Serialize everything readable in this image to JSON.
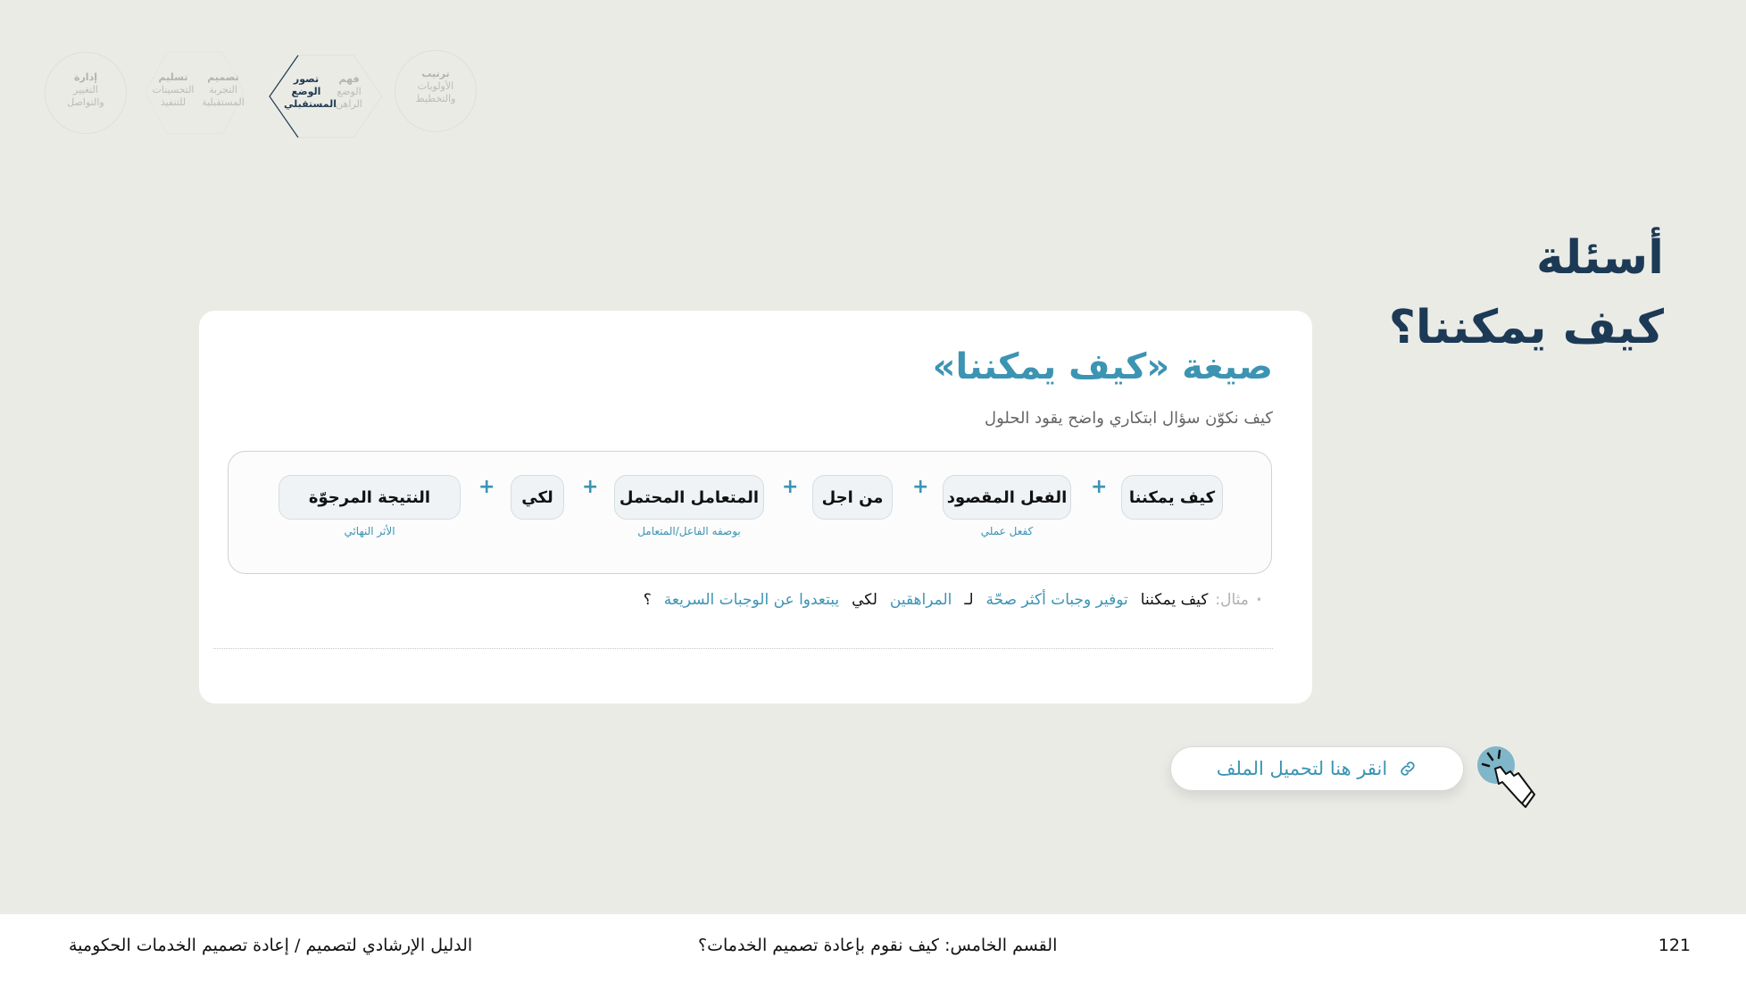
{
  "nav": {
    "stages": [
      {
        "title": "ترتيب",
        "sub1": "الأولويات",
        "sub2": "والتخطيط"
      },
      {
        "title": "فهم",
        "sub1": "الوضع",
        "sub2": "الراهن"
      },
      {
        "title": "تصور",
        "sub1": "الوضع",
        "sub2": "المستقبلي"
      },
      {
        "title": "تصميم",
        "sub1": "التجربة",
        "sub2": "المستقبلية"
      },
      {
        "title": "تسليم",
        "sub1": "التحسينات",
        "sub2": "للتنفيذ"
      },
      {
        "title": "إدارة",
        "sub1": "التغيير",
        "sub2": "والتواصل"
      }
    ]
  },
  "heading": {
    "line1": "أسئلة",
    "line2": "كيف يمكننا؟"
  },
  "card": {
    "title": "صيغة «كيف يمكننا»",
    "subtitle": "كيف نكوّن سؤال ابتكاري واضح يقود الحلول",
    "formula": {
      "chips": [
        {
          "label": "كيف يمكننا",
          "note": ""
        },
        {
          "label": "الفعل المقصود",
          "note": "كفعل عملي"
        },
        {
          "label": "من اجل",
          "note": ""
        },
        {
          "label": "المتعامل المحتمل",
          "note": "بوصفه الفاعل/المتعامل"
        },
        {
          "label": "لكي",
          "note": ""
        },
        {
          "label": "النتيجة المرجوّة",
          "note": "الأثر النهائي"
        }
      ],
      "plus": "+"
    },
    "example": {
      "label": "مثال:",
      "p1": "كيف يمكننا",
      "p2": "توفير وجبات أكثر صحّة",
      "p3": "لـ",
      "p4": "المراهقين",
      "p5": "لكي",
      "p6": "يبتعدوا عن الوجبات السريعة",
      "p7": "؟"
    }
  },
  "download": {
    "label": "انقر هنا لتحميل الملف"
  },
  "footer": {
    "page_number": "121",
    "section": "القسم الخامس: كيف نقوم بإعادة تصميم الخدمات؟",
    "guide": "الدليل الإرشادي لتصميم / إعادة تصميم الخدمات الحكومية"
  },
  "colors": {
    "accent": "#3c94b3",
    "heading": "#1c3a55",
    "background": "#ebebe6"
  }
}
